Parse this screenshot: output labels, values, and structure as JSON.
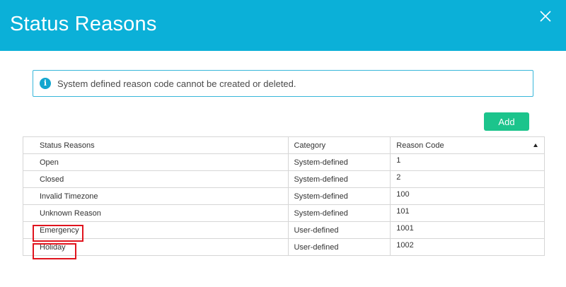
{
  "header": {
    "title": "Status Reasons",
    "close_icon": "close-icon",
    "color": "#0bb0d8"
  },
  "alert": {
    "icon": "info-icon",
    "icon_glyph": "i",
    "text": "System defined reason code cannot be created or deleted."
  },
  "toolbar": {
    "add_label": "Add",
    "add_color": "#1cc48c"
  },
  "table": {
    "columns": [
      "Status Reasons",
      "Category",
      "Reason Code"
    ],
    "sort_column": "Reason Code",
    "sort_direction": "ascending",
    "rows": [
      {
        "name": "Open",
        "category": "System-defined",
        "code": "1"
      },
      {
        "name": "Closed",
        "category": "System-defined",
        "code": "2"
      },
      {
        "name": "Invalid Timezone",
        "category": "System-defined",
        "code": "100"
      },
      {
        "name": "Unknown Reason",
        "category": "System-defined",
        "code": "101"
      },
      {
        "name": "Emergency",
        "category": "User-defined",
        "code": "1001"
      },
      {
        "name": "Holiday",
        "category": "User-defined",
        "code": "1002"
      }
    ]
  },
  "highlight_color": "#e0141e"
}
